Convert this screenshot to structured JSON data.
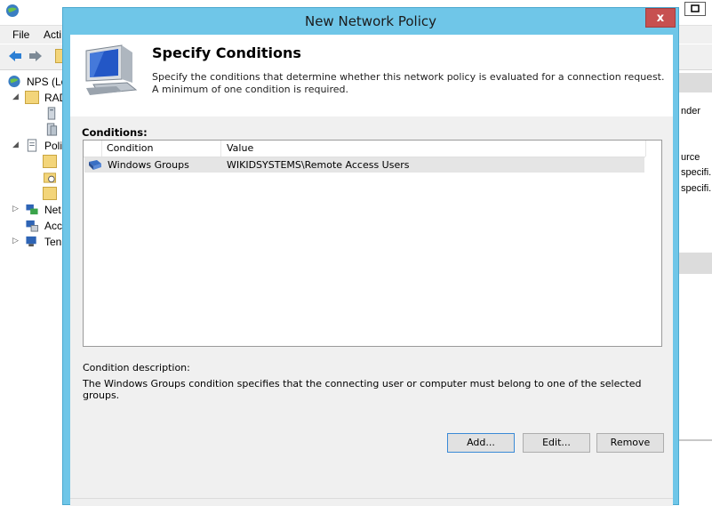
{
  "background_window": {
    "menu": [
      "File",
      "Acti"
    ],
    "tree": [
      {
        "label": "NPS (Lo",
        "level": 0,
        "expander": ""
      },
      {
        "label": "RAD",
        "level": 1,
        "expander": "◢"
      },
      {
        "label": "",
        "level": 2,
        "expander": ""
      },
      {
        "label": "",
        "level": 2,
        "expander": ""
      },
      {
        "label": "Poli",
        "level": 1,
        "expander": "◢"
      },
      {
        "label": "",
        "level": 2,
        "expander": ""
      },
      {
        "label": "",
        "level": 2,
        "expander": ""
      },
      {
        "label": "",
        "level": 2,
        "expander": ""
      },
      {
        "label": "Net",
        "level": 1,
        "expander": "▷"
      },
      {
        "label": "Acc",
        "level": 1,
        "expander": ""
      },
      {
        "label": "Ten",
        "level": 1,
        "expander": "▷"
      }
    ],
    "right_pane": {
      "text_nder": "nder",
      "text_urce": "urce",
      "text_specifi_1": "specifi.",
      "text_specifi_2": "specifi."
    }
  },
  "dialog": {
    "title": "New Network Policy",
    "close_glyph": "x",
    "header": {
      "title": "Specify Conditions",
      "description": "Specify the conditions that determine whether this network policy is evaluated for a connection request. A minimum of one condition is required."
    },
    "conditions_label": "Conditions:",
    "columns": {
      "condition": "Condition",
      "value": "Value"
    },
    "rows": [
      {
        "icon": "group-icon",
        "condition": "Windows Groups",
        "value": "WIKIDSYSTEMS\\Remote Access Users"
      }
    ],
    "description_label": "Condition description:",
    "description_text": "The Windows Groups condition specifies that the connecting user or computer must belong to one of the selected groups.",
    "buttons": {
      "add": "Add...",
      "edit": "Edit...",
      "remove": "Remove"
    }
  }
}
